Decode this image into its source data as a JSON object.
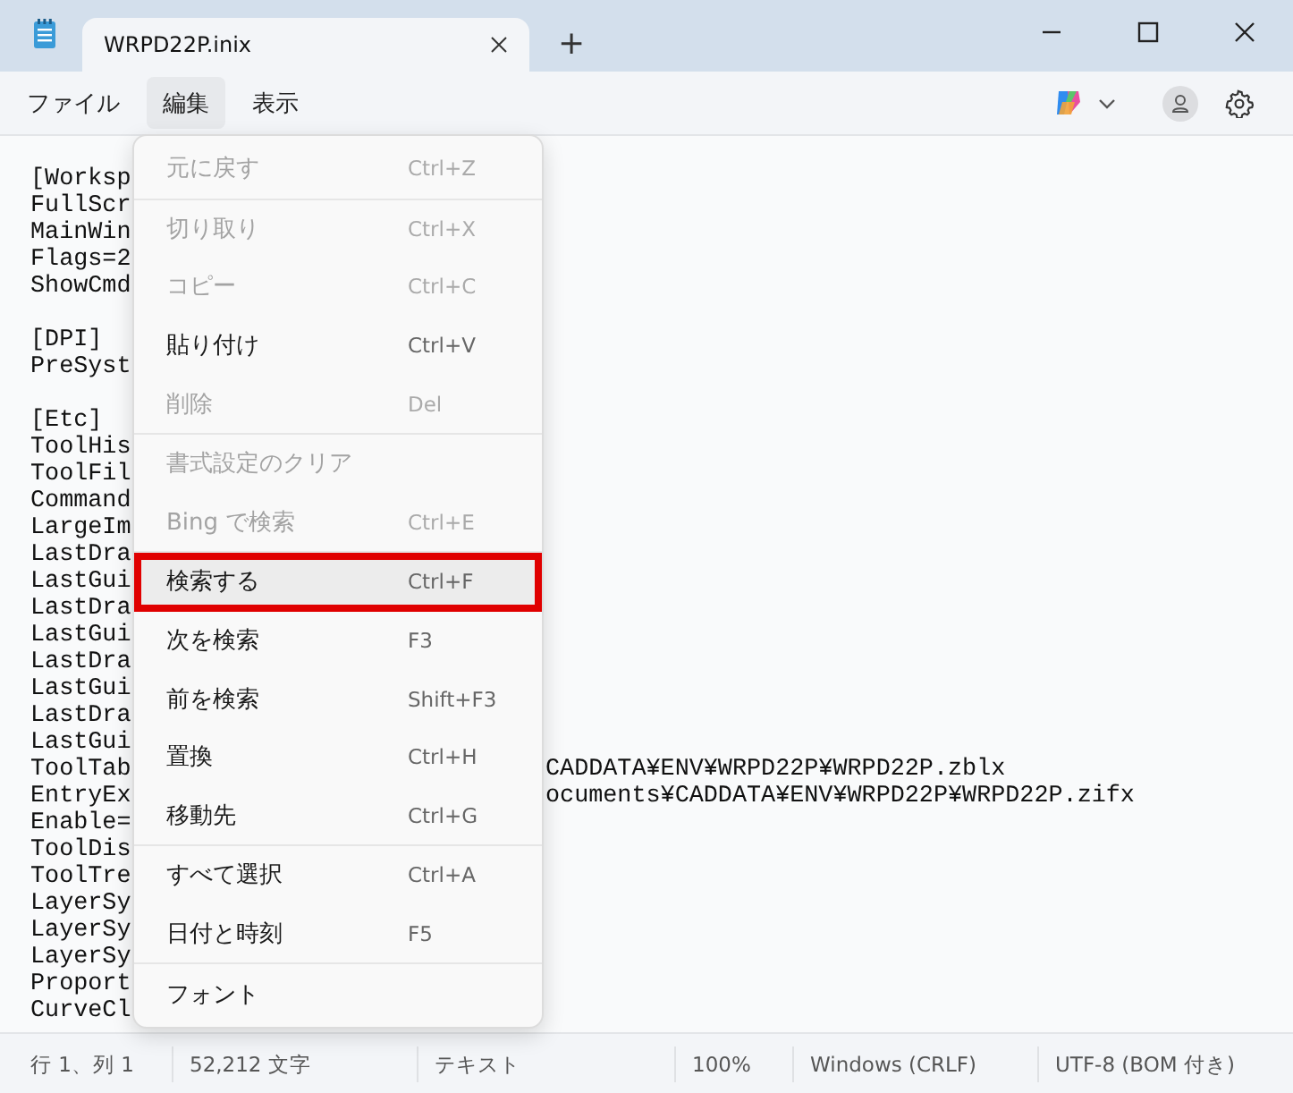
{
  "window": {
    "tab_title": "WRPD22P.inix",
    "new_tab": "+"
  },
  "menubar": [
    {
      "label": "ファイル",
      "selected": false
    },
    {
      "label": "編集",
      "selected": true
    },
    {
      "label": "表示",
      "selected": false
    }
  ],
  "editor": {
    "sections": [
      {
        "lines": [
          {
            "left": "[Worksp"
          },
          {
            "left": "FullScr"
          },
          {
            "left": "MainWin"
          },
          {
            "left": "Flags=2"
          },
          {
            "left": "ShowCmd"
          }
        ]
      },
      {
        "lines": [
          {
            "left": "[DPI]"
          },
          {
            "left": "PreSyst"
          }
        ]
      },
      {
        "lines": [
          {
            "left": "[Etc]"
          },
          {
            "left": "ToolHis"
          },
          {
            "left": "ToolFil"
          },
          {
            "left": "Command"
          },
          {
            "left": "LargeIm"
          },
          {
            "left": "LastDra"
          },
          {
            "left": "LastGui"
          },
          {
            "left": "LastDra"
          },
          {
            "left": "LastGui"
          },
          {
            "left": "LastDra"
          },
          {
            "left": "LastGui"
          },
          {
            "left": "LastDra"
          },
          {
            "left": "LastGui"
          },
          {
            "left": "ToolTab",
            "right": "CADDATA¥ENV¥WRPD22P¥WRPD22P.zblx"
          },
          {
            "left": "EntryEx",
            "right": "ocuments¥CADDATA¥ENV¥WRPD22P¥WRPD22P.zifx"
          },
          {
            "left": "Enable="
          },
          {
            "left": "ToolDis"
          },
          {
            "left": "ToolTre"
          },
          {
            "left": "LayerSy"
          },
          {
            "left": "LayerSy"
          },
          {
            "left": "LayerSy"
          },
          {
            "left": "Proport"
          },
          {
            "left": "CurveCl"
          }
        ]
      }
    ]
  },
  "edit_menu": {
    "groups": [
      {
        "items": [
          {
            "label": "元に戻す",
            "shortcut": "Ctrl+Z",
            "disabled": true,
            "selected": false
          }
        ]
      },
      {
        "items": [
          {
            "label": "切り取り",
            "shortcut": "Ctrl+X",
            "disabled": true,
            "selected": false
          },
          {
            "label": "コピー",
            "shortcut": "Ctrl+C",
            "disabled": true,
            "selected": false
          },
          {
            "label": "貼り付け",
            "shortcut": "Ctrl+V",
            "disabled": false,
            "selected": false
          },
          {
            "label": "削除",
            "shortcut": "Del",
            "disabled": true,
            "selected": false
          }
        ]
      },
      {
        "items": [
          {
            "label": "書式設定のクリア",
            "disabled": true,
            "selected": false
          },
          {
            "label": "Bing で検索",
            "shortcut": "Ctrl+E",
            "disabled": true,
            "selected": false
          }
        ]
      },
      {
        "items": [
          {
            "label": "検索する",
            "shortcut": "Ctrl+F",
            "disabled": false,
            "selected": true
          },
          {
            "label": "次を検索",
            "shortcut": "F3",
            "disabled": false,
            "selected": false
          },
          {
            "label": "前を検索",
            "shortcut": "Shift+F3",
            "disabled": false,
            "selected": false
          },
          {
            "label": "置換",
            "shortcut": "Ctrl+H",
            "disabled": false,
            "selected": false
          },
          {
            "label": "移動先",
            "shortcut": "Ctrl+G",
            "disabled": false,
            "selected": false
          }
        ]
      },
      {
        "items": [
          {
            "label": "すべて選択",
            "shortcut": "Ctrl+A",
            "disabled": false,
            "selected": false
          },
          {
            "label": "日付と時刻",
            "shortcut": "F5",
            "disabled": false,
            "selected": false
          }
        ]
      },
      {
        "items": [
          {
            "label": "フォント",
            "disabled": false,
            "selected": false
          }
        ]
      }
    ]
  },
  "status_bar": [
    "行 1、列 1",
    "52,212 文字",
    "テキスト",
    "100%",
    "Windows (CRLF)",
    "UTF-8 (BOM 付き)"
  ]
}
